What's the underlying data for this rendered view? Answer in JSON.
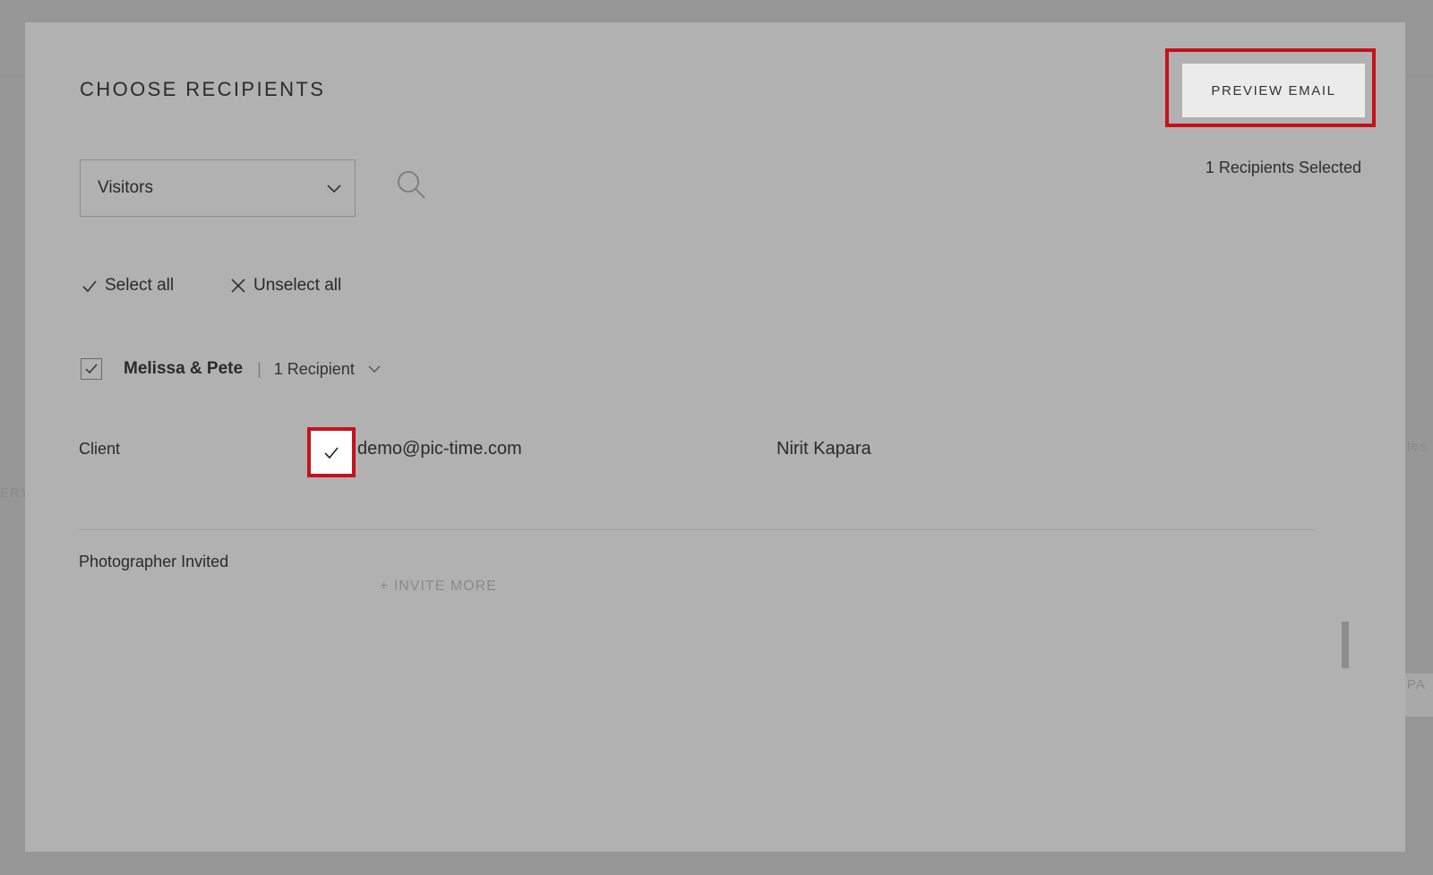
{
  "background": {
    "left_fragment": "ERY",
    "right_fragment": "les",
    "right_fragment_2": "PA"
  },
  "modal": {
    "title": "CHOOSE RECIPIENTS",
    "preview_button_label": "PREVIEW EMAIL",
    "selected_count_text": "1 Recipients Selected",
    "filter": {
      "selected_value": "Visitors"
    },
    "select_all_label": "Select all",
    "unselect_all_label": "Unselect all",
    "group": {
      "name": "Melissa & Pete",
      "separator": "|",
      "recipient_count": "1 Recipient",
      "checked": true
    },
    "recipients": [
      {
        "role": "Client",
        "email": "demo@pic-time.com",
        "name": "Nirit Kapara",
        "checked": true
      }
    ],
    "invited_section": {
      "label": "Photographer Invited",
      "invite_more_label": "+ INVITE MORE"
    }
  },
  "colors": {
    "highlight": "#c5121c",
    "overlay": "#979797",
    "modal_background": "#b1b1b1",
    "button_background": "#ebebeb"
  }
}
